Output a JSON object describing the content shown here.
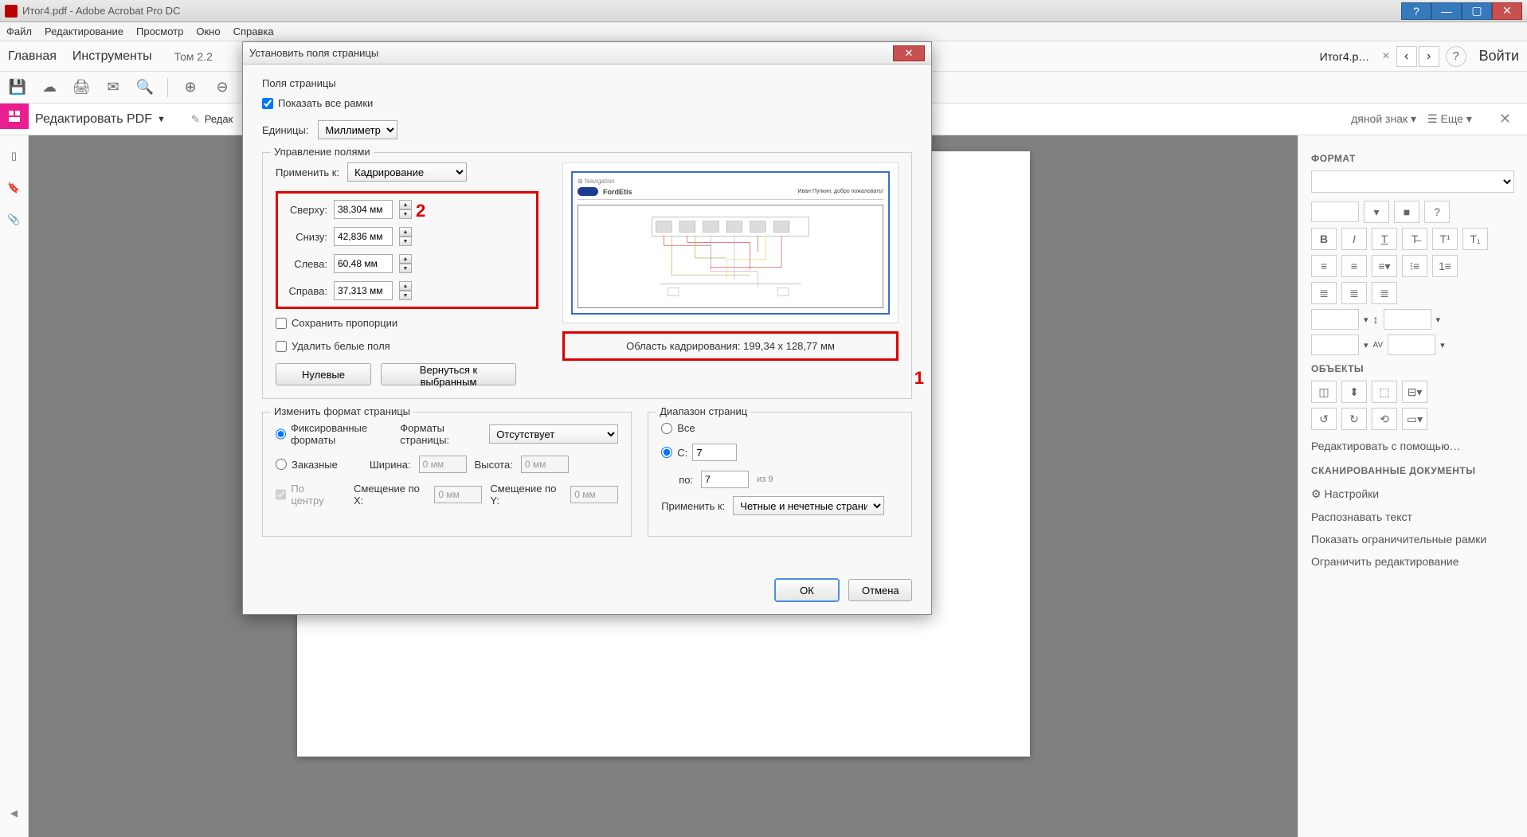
{
  "titlebar": {
    "text": "Итог4.pdf - Adobe Acrobat Pro DC"
  },
  "menu": {
    "file": "Файл",
    "edit": "Редактирование",
    "view": "Просмотр",
    "window": "Окно",
    "help": "Справка"
  },
  "tabs": {
    "home": "Главная",
    "tools": "Инструменты",
    "doc1": "Том 2.2",
    "active": "Итог4.p…",
    "login": "Войти"
  },
  "subtoolbar": {
    "edit_pdf": "Редактировать PDF",
    "redact": "Редак",
    "watermark": "дяной знак",
    "more": "Еще"
  },
  "page": {
    "nav": "Navigation",
    "ford_text": "Fo"
  },
  "rightpanel": {
    "format": "ФОРМАТ",
    "objects": "ОБЪЕКТЫ",
    "edit_with": "Редактировать с помощью…",
    "scanned": "СКАНИРОВАННЫЕ ДОКУМЕНТЫ",
    "settings": "Настройки",
    "recognize": "Распознавать текст",
    "show_bounds": "Показать ограничительные рамки",
    "restrict": "Ограничить редактирование"
  },
  "dialog": {
    "title": "Установить поля страницы",
    "page_fields": "Поля страницы",
    "show_all_frames": "Показать все рамки",
    "units_label": "Единицы:",
    "units_value": "Миллиметры",
    "margin_mgmt": "Управление полями",
    "apply_to": "Применить к:",
    "apply_to_value": "Кадрирование",
    "top_label": "Сверху:",
    "top_value": "38,304 мм",
    "bottom_label": "Снизу:",
    "bottom_value": "42,836 мм",
    "left_label": "Слева:",
    "left_value": "60,48 мм",
    "right_label": "Справа:",
    "right_value": "37,313 мм",
    "keep_proportions": "Сохранить пропорции",
    "remove_white": "Удалить белые поля",
    "zero_btn": "Нулевые",
    "revert_btn": "Вернуться к выбранным",
    "crop_area": "Область кадрирования: 199,34 x 128,77 мм",
    "annotation1": "1",
    "annotation2": "2",
    "change_format": "Изменить формат страницы",
    "fixed_formats": "Фиксированные форматы",
    "custom": "Заказные",
    "page_formats": "Форматы страницы:",
    "page_formats_value": "Отсутствует",
    "width": "Ширина:",
    "width_value": "0 мм",
    "height": "Высота:",
    "height_value": "0 мм",
    "center": "По центру",
    "offset_x": "Смещение по X:",
    "offset_x_value": "0 мм",
    "offset_y": "Смещение по Y:",
    "offset_y_value": "0 мм",
    "page_range": "Диапазон страниц",
    "all": "Все",
    "from": "С:",
    "from_value": "7",
    "to": "по:",
    "to_value": "7",
    "of": "из 9",
    "apply_to2": "Применить к:",
    "apply_to2_value": "Четные и нечетные страницы",
    "ok": "ОК",
    "cancel": "Отмена",
    "preview_brand": "FordEtis",
    "preview_nav": "Navigation"
  }
}
